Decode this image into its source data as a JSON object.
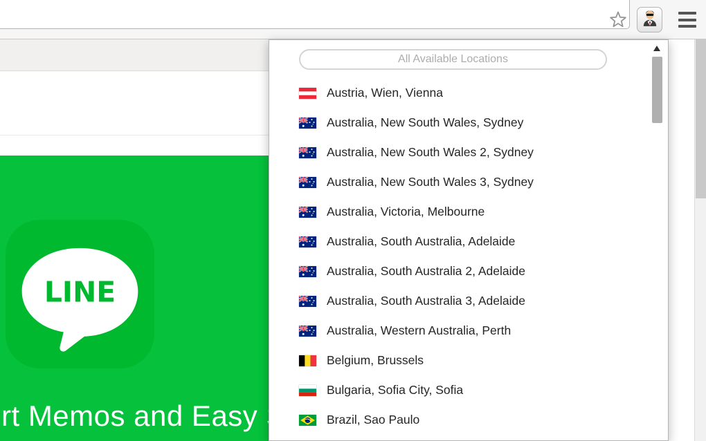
{
  "browser": {
    "toolbar": {
      "address_value": "",
      "icons": {
        "bookmark": "star-outline-icon",
        "extension": "proxy-agent-avatar-icon",
        "menu": "hamburger-menu-icon"
      }
    }
  },
  "popup": {
    "search_placeholder": "All Available Locations",
    "locations": [
      {
        "flag": "at",
        "label": "Austria, Wien, Vienna"
      },
      {
        "flag": "au",
        "label": "Australia, New South Wales, Sydney"
      },
      {
        "flag": "au",
        "label": "Australia, New South Wales 2, Sydney"
      },
      {
        "flag": "au",
        "label": "Australia, New South Wales 3, Sydney"
      },
      {
        "flag": "au",
        "label": "Australia, Victoria, Melbourne"
      },
      {
        "flag": "au",
        "label": "Australia, South Australia, Adelaide"
      },
      {
        "flag": "au",
        "label": "Australia, South Australia 2, Adelaide"
      },
      {
        "flag": "au",
        "label": "Australia, South Australia 3, Adelaide"
      },
      {
        "flag": "au",
        "label": "Australia, Western Australia, Perth"
      },
      {
        "flag": "be",
        "label": "Belgium, Brussels"
      },
      {
        "flag": "bg",
        "label": "Bulgaria, Sofia City, Sofia"
      },
      {
        "flag": "br",
        "label": "Brazil, Sao Paulo"
      }
    ]
  },
  "page": {
    "logo_text": "LINE",
    "hero_text": "rt Memos and Easy S",
    "colors": {
      "hero_green": "#05c13c",
      "icon_green": "#00b92e"
    }
  }
}
